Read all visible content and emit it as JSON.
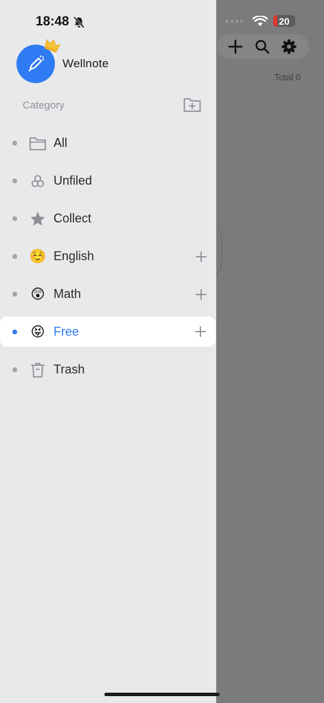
{
  "status": {
    "time": "18:48",
    "battery": "20",
    "battery_level": 0.2
  },
  "background": {
    "total_text": "Total 0"
  },
  "drawer": {
    "app_name": "Wellnote",
    "category_label": "Category",
    "categories": [
      {
        "label": "All",
        "icon": "folder-icon",
        "plus": false,
        "selected": false
      },
      {
        "label": "Unfiled",
        "icon": "unfiled-icon",
        "plus": false,
        "selected": false
      },
      {
        "label": "Collect",
        "icon": "star-icon",
        "plus": false,
        "selected": false
      },
      {
        "label": "English",
        "icon": "smiling-face-emoji",
        "emoji": "☺️",
        "plus": true,
        "selected": false
      },
      {
        "label": "Math",
        "icon": "astonished-face-emoji",
        "emoji": "😲",
        "plus": true,
        "selected": false
      },
      {
        "label": "Free",
        "icon": "tongue-out-face-emoji",
        "emoji": "😝",
        "plus": true,
        "selected": true
      },
      {
        "label": "Trash",
        "icon": "trash-icon",
        "plus": false,
        "selected": false
      }
    ]
  },
  "colors": {
    "accent": "#2f7bf3",
    "drawer_bg": "#e8e9eb",
    "overlay": "#7b7b7d"
  }
}
